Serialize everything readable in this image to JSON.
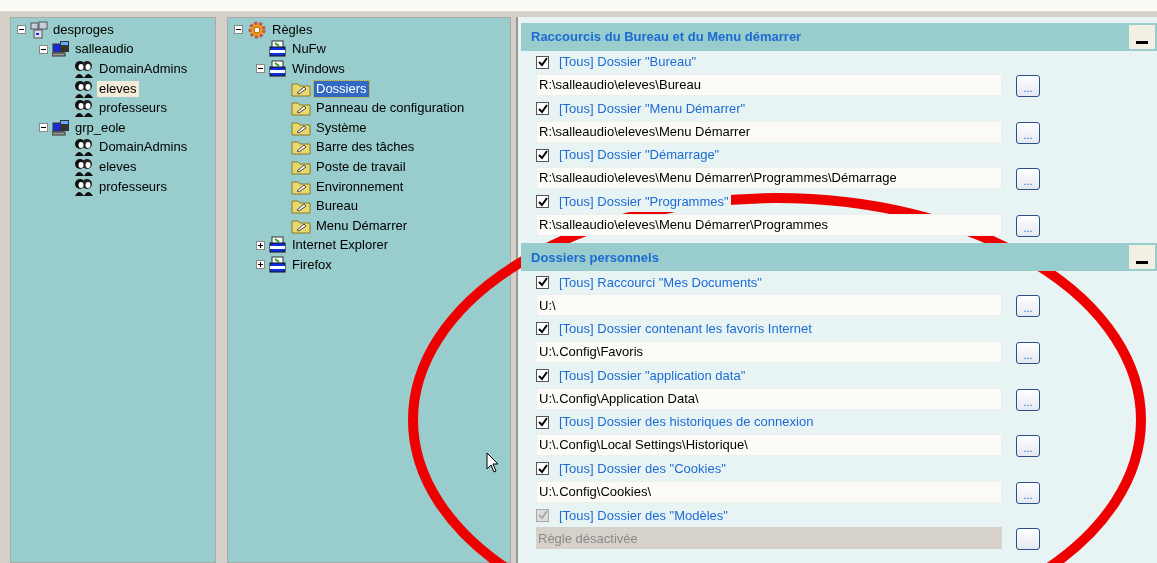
{
  "left_tree": {
    "focused": false,
    "nodes": [
      {
        "label": "desproges",
        "kind": "domain",
        "expanded": true,
        "selected": false,
        "children": [
          {
            "label": "salleaudio",
            "kind": "computer",
            "expanded": true,
            "selected": false,
            "children": [
              {
                "label": "DomainAdmins",
                "kind": "group",
                "selected": false
              },
              {
                "label": "eleves",
                "kind": "group",
                "selected": true
              },
              {
                "label": "professeurs",
                "kind": "group",
                "selected": false
              }
            ]
          },
          {
            "label": "grp_eole",
            "kind": "computer",
            "expanded": true,
            "selected": false,
            "children": [
              {
                "label": "DomainAdmins",
                "kind": "group",
                "selected": false
              },
              {
                "label": "eleves",
                "kind": "group",
                "selected": false
              },
              {
                "label": "professeurs",
                "kind": "group",
                "selected": false
              }
            ]
          }
        ]
      }
    ]
  },
  "rules_tree": {
    "focused": true,
    "nodes": [
      {
        "label": "Règles",
        "kind": "rules",
        "expanded": true,
        "selected": false,
        "children": [
          {
            "label": "NuFw",
            "kind": "policy",
            "selected": false
          },
          {
            "label": "Windows",
            "kind": "policy",
            "expanded": true,
            "selected": false,
            "children": [
              {
                "label": "Dossiers",
                "kind": "folder",
                "selected": true
              },
              {
                "label": "Panneau de configuration",
                "kind": "folder",
                "selected": false
              },
              {
                "label": "Système",
                "kind": "folder",
                "selected": false
              },
              {
                "label": "Barre des tâches",
                "kind": "folder",
                "selected": false
              },
              {
                "label": "Poste de travail",
                "kind": "folder",
                "selected": false
              },
              {
                "label": "Environnement",
                "kind": "folder",
                "selected": false
              },
              {
                "label": "Bureau",
                "kind": "folder",
                "selected": false
              },
              {
                "label": "Menu Démarrer",
                "kind": "folder",
                "selected": false
              }
            ]
          },
          {
            "label": "Internet Explorer",
            "kind": "policy",
            "expanded": false,
            "selected": false
          },
          {
            "label": "Firefox",
            "kind": "policy",
            "expanded": false,
            "selected": false
          }
        ]
      }
    ]
  },
  "sections": [
    {
      "title": "Raccourcis du Bureau et du Menu démarrer",
      "expanded": true,
      "items": [
        {
          "label": "[Tous] Dossier \"Bureau\"",
          "checked": true,
          "disabled": false,
          "value": "R:\\salleaudio\\eleves\\Bureau",
          "button": "..."
        },
        {
          "label": "[Tous] Dossier \"Menu Démarrer\"",
          "checked": true,
          "disabled": false,
          "value": "R:\\salleaudio\\eleves\\Menu Démarrer",
          "button": "..."
        },
        {
          "label": "[Tous] Dossier \"Démarrage\"",
          "checked": true,
          "disabled": false,
          "value": "R:\\salleaudio\\eleves\\Menu Démarrer\\Programmes\\Démarrage",
          "button": "..."
        },
        {
          "label": "[Tous] Dossier \"Programmes\"",
          "checked": true,
          "disabled": false,
          "value": "R:\\salleaudio\\eleves\\Menu Démarrer\\Programmes",
          "button": "..."
        }
      ]
    },
    {
      "title": "Dossiers personnels",
      "expanded": true,
      "items": [
        {
          "label": "[Tous] Raccourci \"Mes Documents\"",
          "checked": true,
          "disabled": false,
          "value": "U:\\",
          "button": "..."
        },
        {
          "label": "[Tous] Dossier contenant les favoris Internet",
          "checked": true,
          "disabled": false,
          "value": "U:\\.Config\\Favoris",
          "button": "..."
        },
        {
          "label": "[Tous] Dossier \"application data\"",
          "checked": true,
          "disabled": false,
          "value": "U:\\.Config\\Application Data\\",
          "button": "..."
        },
        {
          "label": "[Tous] Dossier des historiques de connexion",
          "checked": true,
          "disabled": false,
          "value": "U:\\.Config\\Local Settings\\Historique\\",
          "button": "..."
        },
        {
          "label": "[Tous] Dossier des \"Cookies\"",
          "checked": true,
          "disabled": false,
          "value": "U:\\.Config\\Cookies\\",
          "button": "..."
        },
        {
          "label": "[Tous] Dossier des \"Modèles\"",
          "checked": true,
          "disabled": true,
          "value": "Règle désactivée"
        }
      ]
    }
  ]
}
